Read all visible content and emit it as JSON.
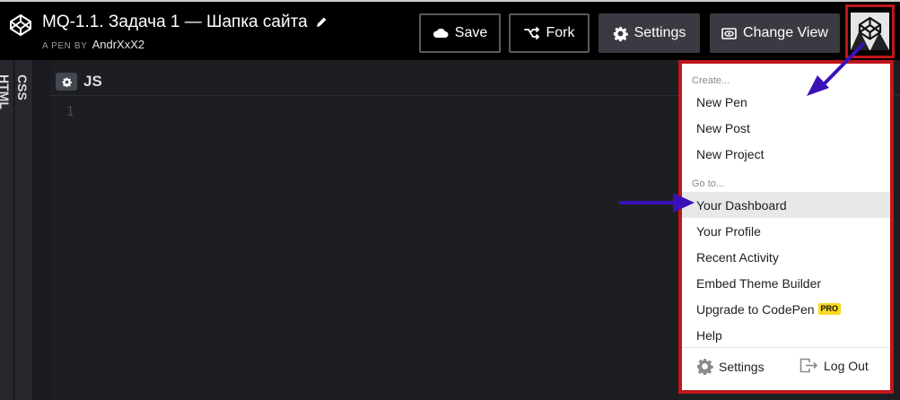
{
  "header": {
    "title": "MQ-1.1. Задача 1 — Шапка сайта",
    "byline_prefix": "A PEN BY",
    "author": "AndrXxX2",
    "buttons": {
      "save": "Save",
      "fork": "Fork",
      "settings": "Settings",
      "change_view": "Change View"
    }
  },
  "editor": {
    "panels": [
      "HTML",
      "CSS",
      "JS"
    ],
    "active_panel": "JS",
    "line_numbers": [
      "1"
    ]
  },
  "menu": {
    "create_section": "Create...",
    "create_items": [
      "New Pen",
      "New Post",
      "New Project"
    ],
    "goto_section": "Go to...",
    "goto_items": [
      "Your Dashboard",
      "Your Profile",
      "Recent Activity",
      "Embed Theme Builder",
      "Upgrade to CodePen",
      "Help"
    ],
    "pro_badge": "PRO",
    "highlighted_item": "Your Dashboard",
    "footer": {
      "settings": "Settings",
      "logout": "Log Out"
    }
  },
  "colors": {
    "header_bg": "#000000",
    "editor_bg": "#1d1e22",
    "highlight_border": "#c0161a",
    "annotation_arrow": "#3a12b8",
    "pro_badge": "#f8d91e"
  },
  "icons": [
    "codepen-logo-icon",
    "pencil-icon",
    "cloud-icon",
    "fork-icon",
    "gear-icon",
    "eye-icon",
    "logout-icon"
  ]
}
